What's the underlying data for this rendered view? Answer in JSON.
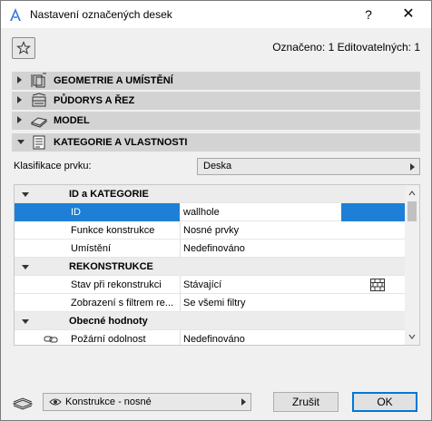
{
  "window": {
    "title": "Nastavení označených desek",
    "help_label": "?",
    "close_label": "✕"
  },
  "header": {
    "selected_info": "Označeno: 1 Editovatelných: 1"
  },
  "sections": [
    {
      "label": "GEOMETRIE A UMÍSTĚNÍ",
      "icon": "geometry-icon",
      "expanded": false
    },
    {
      "label": "PŮDORYS A ŘEZ",
      "icon": "floorplan-icon",
      "expanded": false
    },
    {
      "label": "MODEL",
      "icon": "model-icon",
      "expanded": false
    },
    {
      "label": "KATEGORIE A VLASTNOSTI",
      "icon": "properties-icon",
      "expanded": true
    }
  ],
  "classification": {
    "label": "Klasifikace prvku:",
    "value": "Deska"
  },
  "table": {
    "groups": [
      {
        "name": "ID a KATEGORIE",
        "rows": [
          {
            "name": "ID",
            "value": "wallhole",
            "selected": true
          },
          {
            "name": "Funkce konstrukce",
            "value": "Nosné prvky"
          },
          {
            "name": "Umístění",
            "value": "Nedefinováno"
          }
        ]
      },
      {
        "name": "REKONSTRUKCE",
        "rows": [
          {
            "name": "Stav při rekonstrukci",
            "value": "Stávající",
            "icon": "brick-wall-icon"
          },
          {
            "name": "Zobrazení s filtrem re...",
            "value": "Se všemi filtry"
          }
        ]
      },
      {
        "name": "Obecné hodnoty",
        "rows": [
          {
            "name": "Požární odolnost",
            "value": "Nedefinováno",
            "icon": "link-icon"
          }
        ]
      }
    ]
  },
  "footer": {
    "layer_value": "Konstrukce - nosné",
    "cancel_label": "Zrušit",
    "ok_label": "OK"
  },
  "colors": {
    "selection": "#1e7fd6",
    "section_bg": "#d3d3d3",
    "dialog_bg": "#f0f0f0"
  }
}
